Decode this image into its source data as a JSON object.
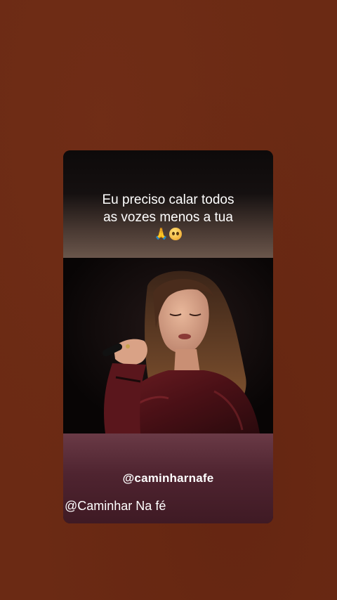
{
  "post": {
    "caption_lines": [
      "Eu preciso calar todos",
      "as vozes menos a tua"
    ],
    "caption_emojis": [
      "praying-hands-emoji",
      "pleading-face-emoji"
    ],
    "handle_center": "@caminharnafe",
    "handle_left": "@Caminhar Na fé"
  },
  "colors": {
    "background": "#6b2a14",
    "card_bottom": "#4f2430"
  }
}
